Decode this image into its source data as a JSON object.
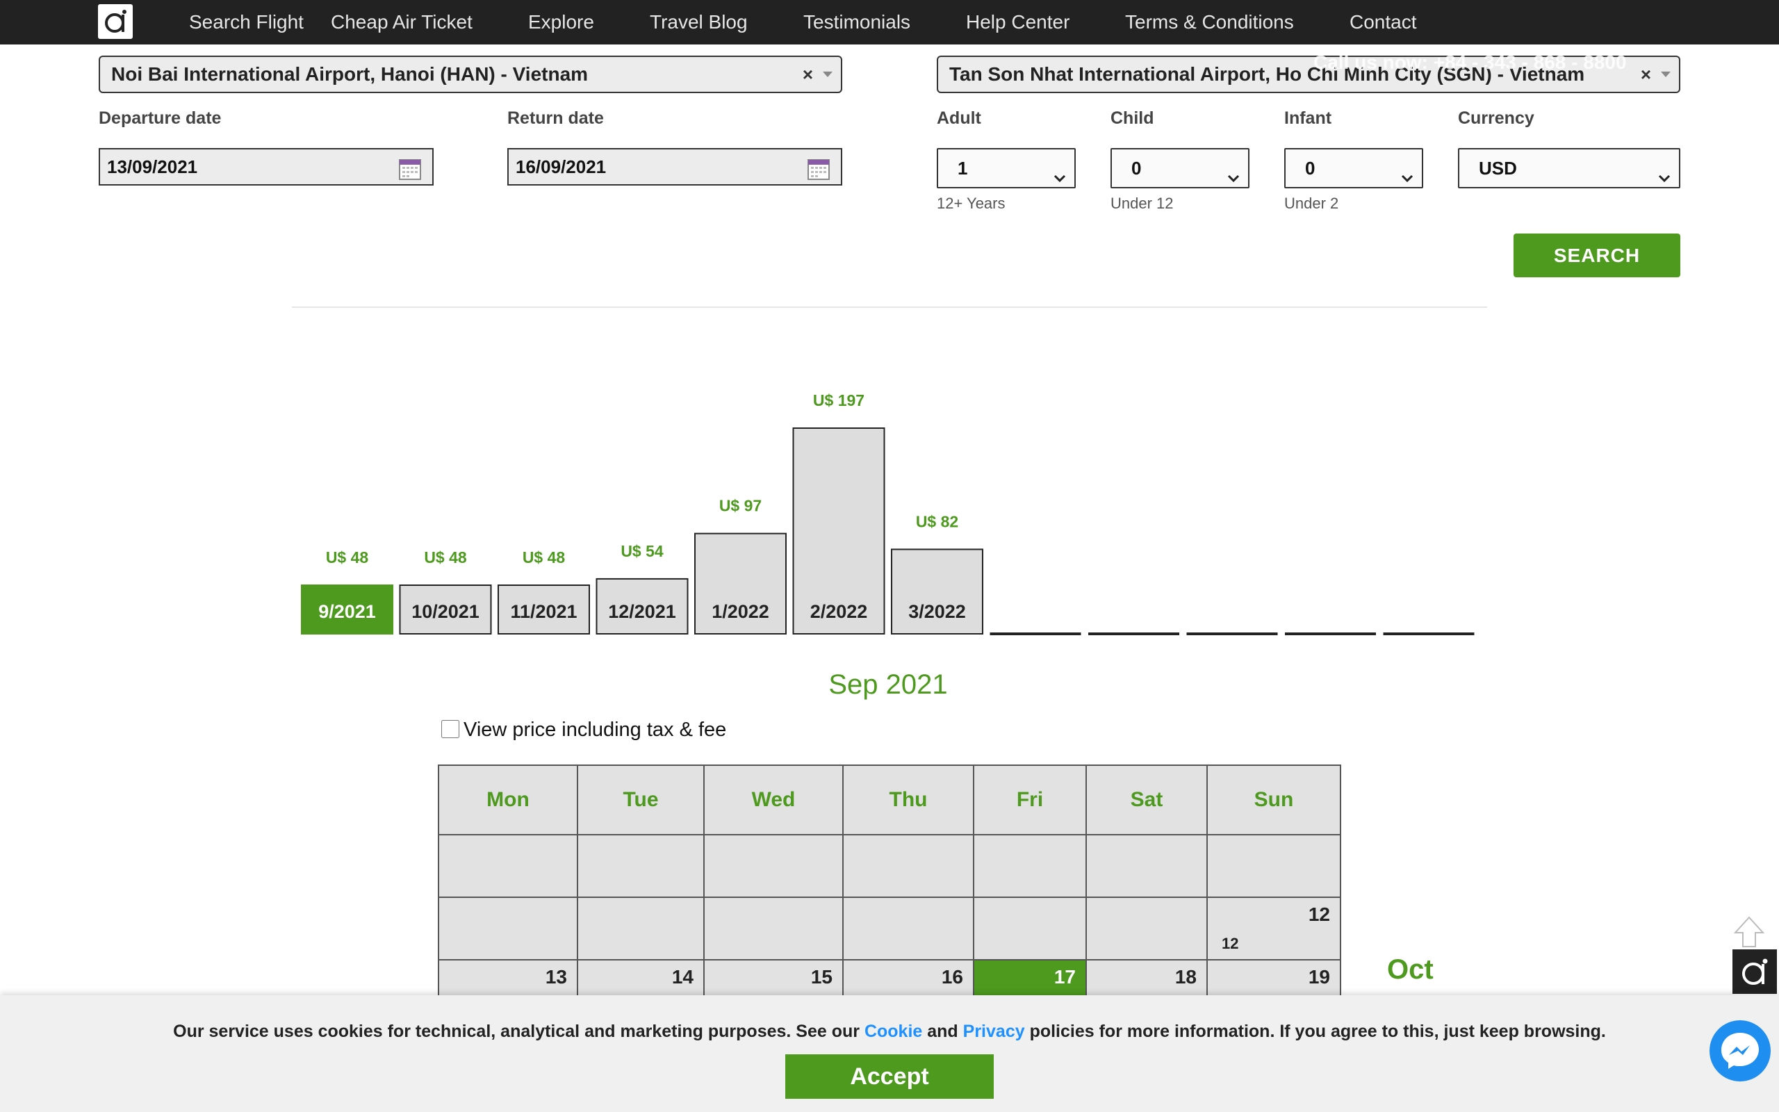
{
  "nav": {
    "items": [
      "Search Flight",
      "Cheap Air Ticket",
      "Explore",
      "Travel Blog",
      "Testimonials",
      "Help Center",
      "Terms & Conditions",
      "Contact"
    ]
  },
  "form": {
    "from_airport": "Noi Bai International Airport, Hanoi (HAN) - Vietnam",
    "to_airport": "Tan Son Nhat International Airport, Ho Chi Minh City (SGN) - Vietnam",
    "callus": "Call us now: +84 - 343 - 868 - 8800",
    "clear_symbol": "×",
    "departure_label": "Departure date",
    "return_label": "Return date",
    "departure_value": "13/09/2021",
    "return_value": "16/09/2021",
    "adult_label": "Adult",
    "child_label": "Child",
    "infant_label": "Infant",
    "currency_label": "Currency",
    "adult_value": "1",
    "child_value": "0",
    "infant_value": "0",
    "currency_value": "USD",
    "adult_sub": "12+ Years",
    "child_sub": "Under 12",
    "infant_sub": "Under 2",
    "search_label": "SEARCH"
  },
  "chart_data": {
    "type": "bar",
    "categories": [
      "9/2021",
      "10/2021",
      "11/2021",
      "12/2021",
      "1/2022",
      "2/2022",
      "3/2022",
      "",
      "",
      "",
      "",
      ""
    ],
    "values": [
      48,
      48,
      48,
      54,
      97,
      197,
      82,
      null,
      null,
      null,
      null,
      null
    ],
    "labels": [
      "U$ 48",
      "U$ 48",
      "U$ 48",
      "U$ 54",
      "U$ 97",
      "U$ 197",
      "U$ 82",
      "",
      "",
      "",
      "",
      ""
    ],
    "selected": "9/2021",
    "colors": {
      "selected": "#4d9a1f",
      "bar": "#dddddd",
      "price": "#4d9a1f"
    }
  },
  "calendar": {
    "title": "Sep 2021",
    "tax_label": "View price including tax & fee",
    "days": [
      "Mon",
      "Tue",
      "Wed",
      "Thu",
      "Fri",
      "Sat",
      "Sun"
    ],
    "rows": [
      [
        "",
        "",
        "",
        "",
        "",
        "",
        ""
      ],
      [
        "",
        "",
        "",
        "",
        "",
        "",
        "12"
      ],
      [
        "13",
        "14",
        "15",
        "16",
        "17",
        "18",
        "19"
      ]
    ],
    "sun_12_price": "12",
    "selected_day": "17",
    "next_month": "Oct"
  },
  "cookie": {
    "text_before": "Our service uses cookies for technical, analytical and marketing purposes. See our ",
    "cookie_link": "Cookie",
    "and": " and ",
    "privacy_link": "Privacy",
    "text_after": " policies for more information. If you agree to this, just keep browsing.",
    "accept_label": "Accept"
  },
  "icons": {
    "logo": "brand-logo-icon",
    "calendar": "calendar-icon",
    "messenger": "messenger-icon",
    "scroll_top": "arrow-up-icon"
  },
  "colors": {
    "brand_green": "#4d9a1f",
    "nav_bg": "#222222",
    "link_blue": "#1e90ff"
  }
}
